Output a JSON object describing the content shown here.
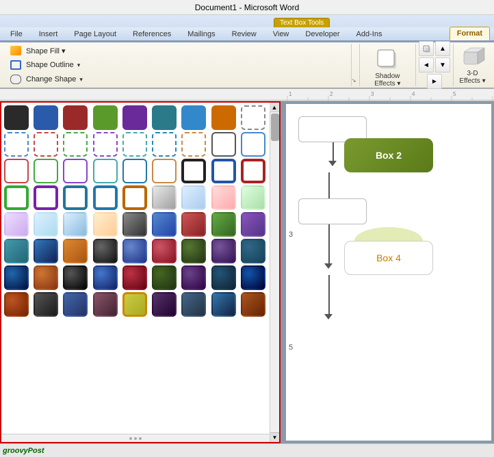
{
  "titlebar": {
    "text": "Document1 - Microsoft Word"
  },
  "ribbon": {
    "textboxtoolslabel": "Text Box Tools",
    "formattab": "Format",
    "tabs": [
      "File",
      "Insert",
      "Page Layout",
      "References",
      "Mailings",
      "Review",
      "View",
      "Developer",
      "Add-Ins"
    ],
    "groups": {
      "shapefill": "Shape Fill",
      "shapeoutline": "Shape Outline",
      "changeshape": "Change Shape",
      "shadoweffects": "Shadow Effects",
      "effects3d": "3-D Effects"
    }
  },
  "statusbar": {
    "logo": "groovyPost"
  },
  "diagram": {
    "box2label": "Box 2",
    "box4label": "Box 4"
  }
}
